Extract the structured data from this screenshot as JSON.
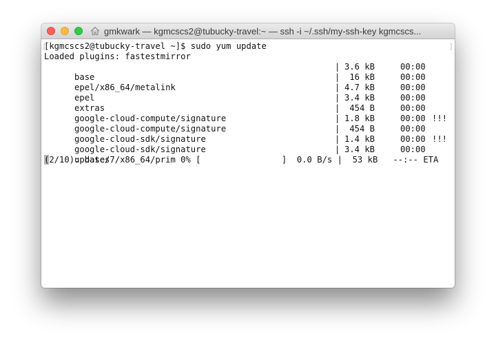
{
  "window": {
    "title": "gmkwark — kgmcscs2@tubucky-travel:~ — ssh -i ~/.ssh/my-ssh-key kgmcscs..."
  },
  "terminal": {
    "scroll_marker_left": "[",
    "scroll_marker_right": "]",
    "prompt_line": "[kgmcscs2@tubucky-travel ~]$ sudo yum update",
    "plugins_line": "Loaded plugins: fastestmirror",
    "repos": [
      {
        "name": "base",
        "pipe": "|",
        "size": "3.6 kB",
        "time": "00:00",
        "flag": ""
      },
      {
        "name": "epel/x86_64/metalink",
        "pipe": "|",
        "size": " 16 kB",
        "time": "00:00",
        "flag": ""
      },
      {
        "name": "epel",
        "pipe": "|",
        "size": "4.7 kB",
        "time": "00:00",
        "flag": ""
      },
      {
        "name": "extras",
        "pipe": "|",
        "size": "3.4 kB",
        "time": "00:00",
        "flag": ""
      },
      {
        "name": "google-cloud-compute/signature",
        "pipe": "|",
        "size": " 454 B",
        "time": "00:00",
        "flag": ""
      },
      {
        "name": "google-cloud-compute/signature",
        "pipe": "|",
        "size": "1.8 kB",
        "time": "00:00",
        "flag": "!!!"
      },
      {
        "name": "google-cloud-sdk/signature",
        "pipe": "|",
        "size": " 454 B",
        "time": "00:00",
        "flag": ""
      },
      {
        "name": "google-cloud-sdk/signature",
        "pipe": "|",
        "size": "1.4 kB",
        "time": "00:00",
        "flag": "!!!"
      },
      {
        "name": "updates",
        "pipe": "|",
        "size": "3.4 kB",
        "time": "00:00",
        "flag": ""
      }
    ],
    "progress": {
      "cursor_char": "(",
      "text": "2/10): base/7/x86_64/prim 0% [                ]  0.0 B/s |  53 kB   --:-- ETA"
    }
  },
  "icons": {
    "home": "home-icon"
  },
  "colors": {
    "close": "#fc605c",
    "minimize": "#fdbc40",
    "maximize": "#34c84a"
  }
}
